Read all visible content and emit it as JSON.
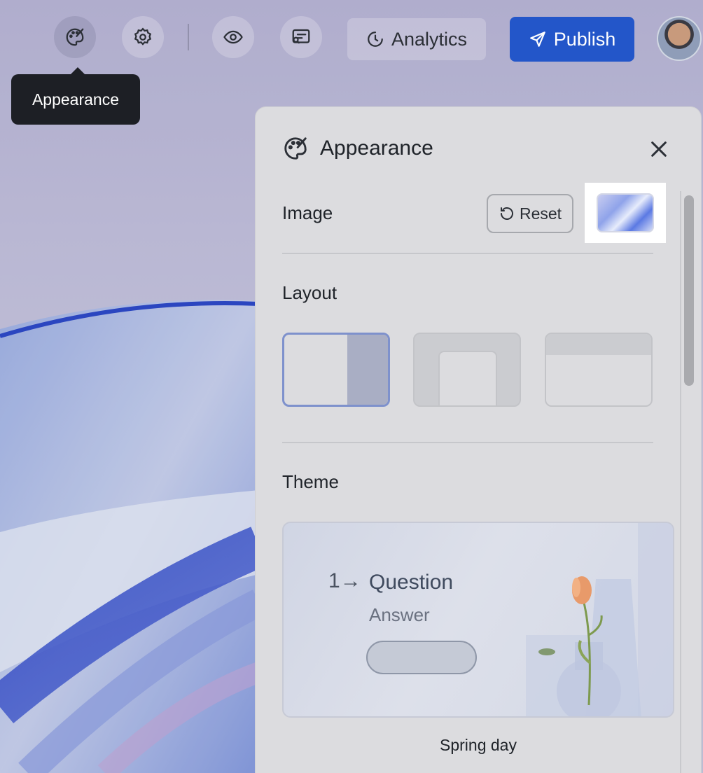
{
  "toolbar": {
    "analytics_label": "Analytics",
    "publish_label": "Publish",
    "tooltip": "Appearance",
    "icons": [
      "palette-icon",
      "gear-icon",
      "eye-icon",
      "form-preview-icon",
      "analytics-icon",
      "send-icon"
    ]
  },
  "panel": {
    "title": "Appearance",
    "image_label": "Image",
    "reset_label": "Reset",
    "layout_label": "Layout",
    "layout_options": [
      "split-right",
      "card-center",
      "banner-top"
    ],
    "selected_layout": "split-right",
    "theme_label": "Theme",
    "theme_card": {
      "number": "1",
      "question": "Question",
      "answer": "Answer",
      "name": "Spring day"
    }
  },
  "colors": {
    "publish": "#2356c9",
    "tooltip": "#1d1f25",
    "panel_bg": "#dcdcdf",
    "selected_border": "#7e91cc"
  }
}
